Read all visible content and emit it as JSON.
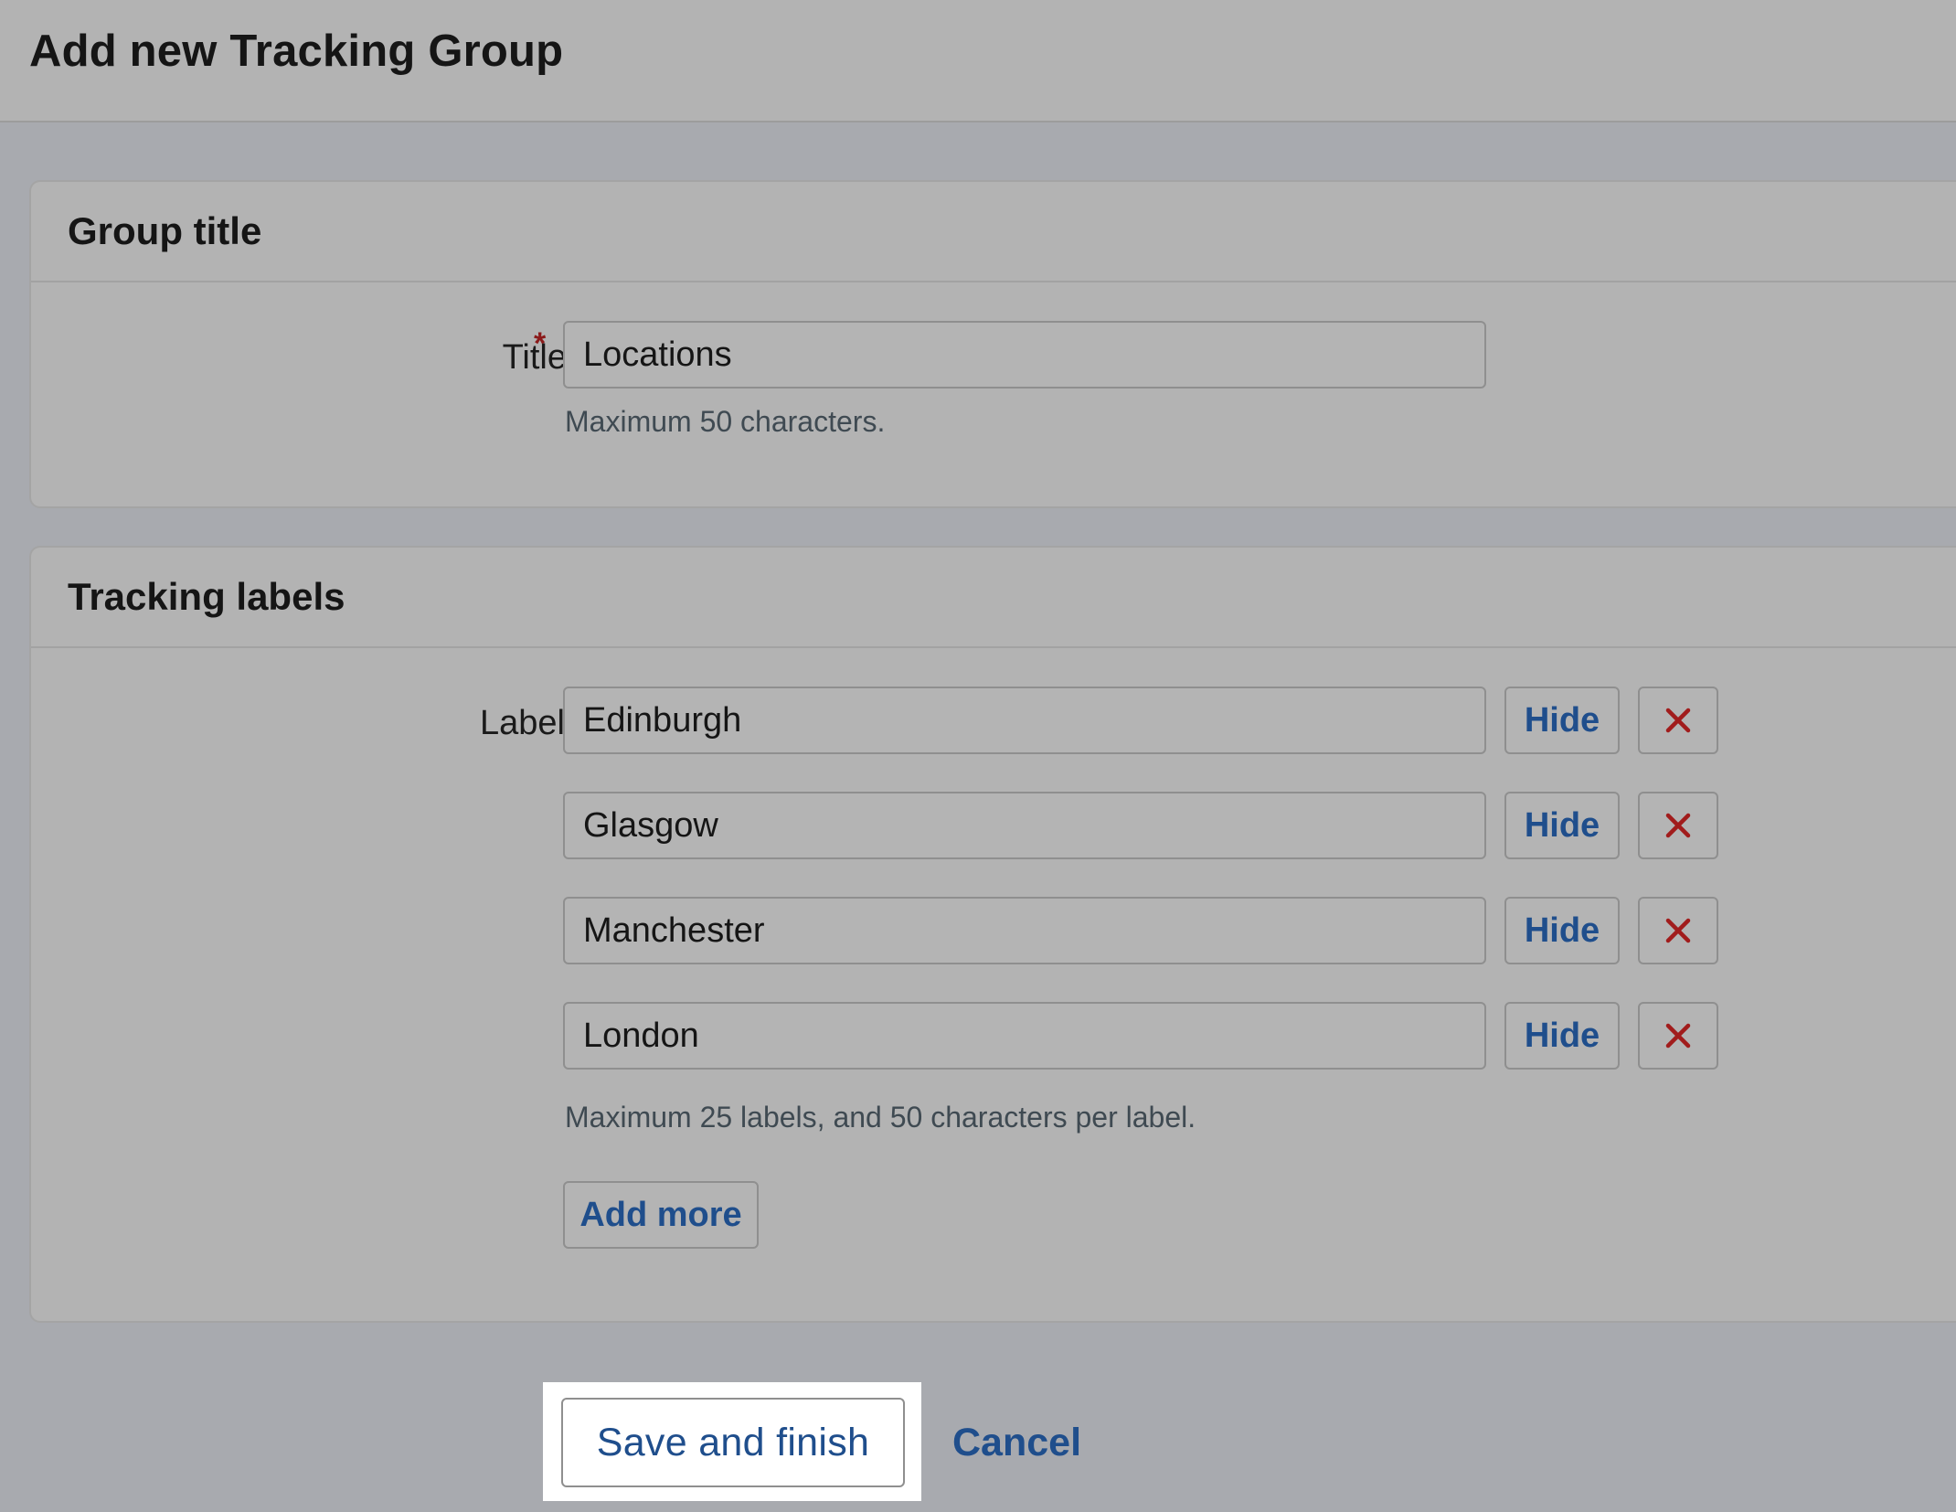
{
  "page": {
    "title": "Add new Tracking Group"
  },
  "group_title_section": {
    "heading": "Group title",
    "title_label": "Title",
    "required_mark": "*",
    "title_value": "Locations",
    "hint": "Maximum 50 characters."
  },
  "tracking_labels_section": {
    "heading": "Tracking labels",
    "label_label": "Label",
    "labels": [
      {
        "value": "Edinburgh",
        "hide_label": "Hide"
      },
      {
        "value": "Glasgow",
        "hide_label": "Hide"
      },
      {
        "value": "Manchester",
        "hide_label": "Hide"
      },
      {
        "value": "London",
        "hide_label": "Hide"
      }
    ],
    "remove_icon": "close-x-icon",
    "hint": "Maximum 25 labels, and 50 characters per label.",
    "add_more_label": "Add more"
  },
  "actions": {
    "save_label": "Save and finish",
    "cancel_label": "Cancel"
  },
  "colors": {
    "link_blue": "#1f4e8c",
    "remove_red": "#a11c1c",
    "required_red": "#8b1a1a"
  }
}
